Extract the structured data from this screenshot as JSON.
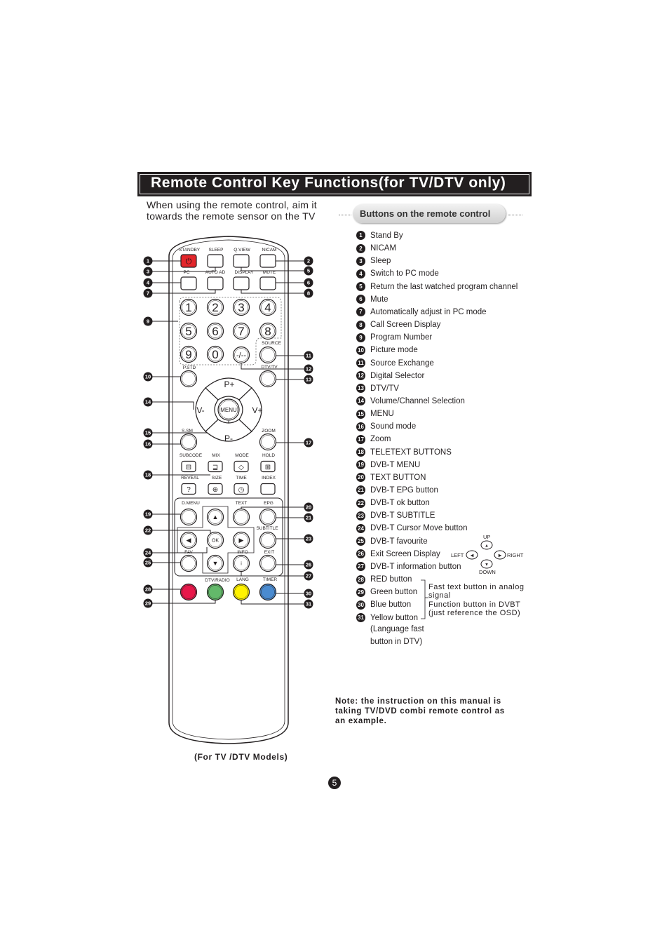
{
  "title": "Remote Control Key Functions(for TV/DTV only)",
  "intro": [
    "When using the remote control, aim it",
    "towards the remote sensor on the TV"
  ],
  "buttons_heading": "Buttons on the remote control",
  "remote": {
    "labels": [
      "STANDBY",
      "SLEEP",
      "Q.VIEW",
      "NICAM",
      "PC",
      "AUTO AD",
      "DISPLAY",
      "MUTE",
      "SOURCE",
      "P.STD",
      "DTV/TV",
      "S.SM",
      "ZOOM",
      "SUBCODE",
      "MIX",
      "MODE",
      "HOLD",
      "REVEAL",
      "SIZE",
      "TIME",
      "INDEX",
      "D.MENU",
      "TEXT",
      "EPG",
      "SUBTITLE",
      "FAV",
      "INFO",
      "EXIT",
      "DTV/RADIO",
      "LANG",
      "TIMER"
    ],
    "digits": [
      "1",
      "2",
      "3",
      "4",
      "5",
      "6",
      "7",
      "8",
      "9",
      "0"
    ],
    "dash_key": "-/--",
    "dpad": {
      "up": "P+",
      "left": "V-",
      "right": "V+",
      "center": "MENU",
      "down": "P-"
    },
    "ok": "OK",
    "info_glyph": "i",
    "color_keys": [
      "#e8174a",
      "#63b96a",
      "#fff200",
      "#4a8bd0"
    ],
    "standby_color": "#e3262b",
    "callouts_left": [
      "1",
      "3",
      "4",
      "7",
      "9",
      "10",
      "14",
      "15",
      "16",
      "18",
      "19",
      "22",
      "24",
      "25",
      "28",
      "29"
    ],
    "callouts_right": [
      "2",
      "5",
      "6",
      "8",
      "11",
      "12",
      "13",
      "17",
      "20",
      "21",
      "23",
      "26",
      "27",
      "30",
      "31"
    ]
  },
  "functions": [
    {
      "n": "1",
      "label": "Stand By"
    },
    {
      "n": "2",
      "label": "NICAM"
    },
    {
      "n": "3",
      "label": "Sleep"
    },
    {
      "n": "4",
      "label": "Switch to PC mode"
    },
    {
      "n": "5",
      "label": "Return the last watched program channel"
    },
    {
      "n": "6",
      "label": "Mute"
    },
    {
      "n": "7",
      "label": "Automatically adjust in PC mode"
    },
    {
      "n": "8",
      "label": "Call Screen Display"
    },
    {
      "n": "9",
      "label": "Program Number"
    },
    {
      "n": "10",
      "label": "Picture mode"
    },
    {
      "n": "11",
      "label": "Source Exchange"
    },
    {
      "n": "12",
      "label": "Digital Selector"
    },
    {
      "n": "13",
      "label": "DTV/TV"
    },
    {
      "n": "14",
      "label": "Volume/Channel Selection"
    },
    {
      "n": "15",
      "label": "MENU"
    },
    {
      "n": "16",
      "label": "Sound mode"
    },
    {
      "n": "17",
      "label": "Zoom"
    },
    {
      "n": "18",
      "label": "TELETEXT BUTTONS"
    },
    {
      "n": "19",
      "label": "DVB-T MENU"
    },
    {
      "n": "20",
      "label": "TEXT BUTTON"
    },
    {
      "n": "21",
      "label": "DVB-T EPG button"
    },
    {
      "n": "22",
      "label": "DVB-T ok button"
    },
    {
      "n": "23",
      "label": "DVB-T SUBTITLE"
    },
    {
      "n": "24",
      "label": "DVB-T Cursor Move button"
    },
    {
      "n": "25",
      "label": "DVB-T favourite"
    },
    {
      "n": "26",
      "label": "Exit Screen Display"
    },
    {
      "n": "27",
      "label": "DVB-T information button"
    },
    {
      "n": "28",
      "label": "RED button"
    },
    {
      "n": "29",
      "label": "Green button"
    },
    {
      "n": "30",
      "label": "Blue button"
    },
    {
      "n": "31",
      "label": "Yellow button"
    }
  ],
  "yellow_note": [
    "(Language fast",
    "button in DTV)"
  ],
  "cursor_diagram": {
    "up": "UP",
    "left": "LEFT",
    "right": "RIGHT",
    "down": "DOWN"
  },
  "color_side_note": [
    "Fast text button in analog",
    "signal",
    "Function button in DVBT",
    "(just reference the OSD)"
  ],
  "note": [
    "Note: the instruction on this manual is",
    "taking TV/DVD combi remote control as",
    "an example."
  ],
  "caption": "(For TV /DTV Models)",
  "page_number": "5"
}
